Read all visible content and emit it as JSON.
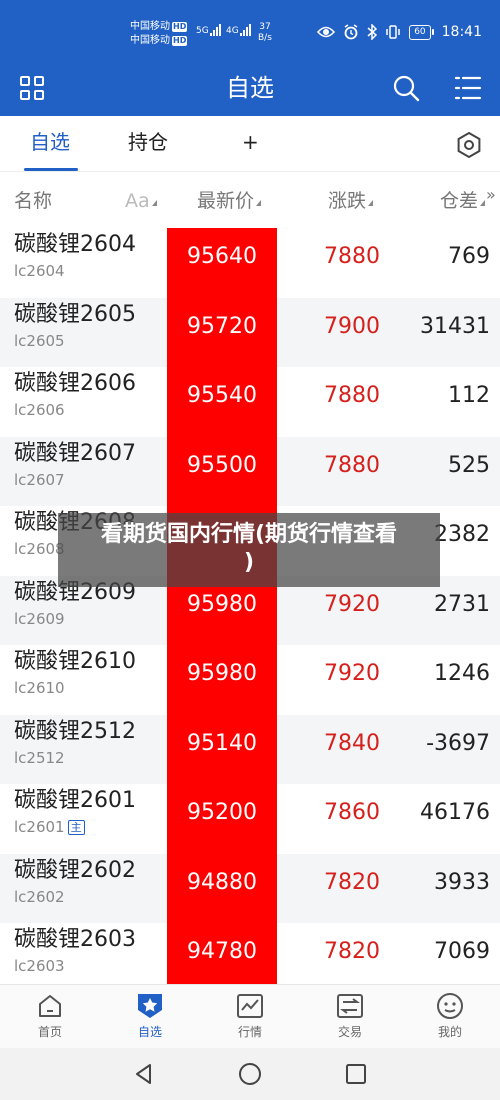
{
  "status_bar": {
    "carrier1": "中国移动",
    "carrier2": "中国移动",
    "hd": "HD",
    "net1": "5G",
    "net2": "4G",
    "speed_value": "37",
    "speed_unit": "B/s",
    "battery": "60",
    "time": "18:41"
  },
  "header": {
    "title": "自选",
    "icons": [
      "grid-menu-icon",
      "search-icon",
      "list-menu-icon"
    ]
  },
  "tabs": {
    "items": [
      "自选",
      "持仓",
      "+"
    ],
    "active": "自选",
    "settings_icon": "hexagon-settings-icon"
  },
  "columns": {
    "name": "名称",
    "font": "Aa",
    "price": "最新价",
    "change": "涨跌",
    "oi": "仓差",
    "more": "»"
  },
  "rows": [
    {
      "name": "碳酸锂2604",
      "code": "lc2604",
      "price": "95640",
      "change": "7880",
      "oi": "769"
    },
    {
      "name": "碳酸锂2605",
      "code": "lc2605",
      "price": "95720",
      "change": "7900",
      "oi": "31431"
    },
    {
      "name": "碳酸锂2606",
      "code": "lc2606",
      "price": "95540",
      "change": "7880",
      "oi": "112"
    },
    {
      "name": "碳酸锂2607",
      "code": "lc2607",
      "price": "95500",
      "change": "7880",
      "oi": "525"
    },
    {
      "name": "碳酸锂2608",
      "code": "lc2608",
      "price": "",
      "change": "",
      "oi": "2382"
    },
    {
      "name": "碳酸锂2609",
      "code": "lc2609",
      "price": "95980",
      "change": "7920",
      "oi": "2731"
    },
    {
      "name": "碳酸锂2610",
      "code": "lc2610",
      "price": "95980",
      "change": "7920",
      "oi": "1246"
    },
    {
      "name": "碳酸锂2512",
      "code": "lc2512",
      "price": "95140",
      "change": "7840",
      "oi": "-3697"
    },
    {
      "name": "碳酸锂2601",
      "code": "lc2601",
      "badge": "主",
      "price": "95200",
      "change": "7860",
      "oi": "46176"
    },
    {
      "name": "碳酸锂2602",
      "code": "lc2602",
      "price": "94880",
      "change": "7820",
      "oi": "3933"
    },
    {
      "name": "碳酸锂2603",
      "code": "lc2603",
      "price": "94780",
      "change": "7820",
      "oi": "7069"
    }
  ],
  "overlay": {
    "line1": "看期货国内行情(期货行情查看",
    "line2": ")"
  },
  "bottom_nav": [
    {
      "label": "首页",
      "icon": "home-icon"
    },
    {
      "label": "自选",
      "icon": "star-shield-icon",
      "active": true
    },
    {
      "label": "行情",
      "icon": "chart-icon"
    },
    {
      "label": "交易",
      "icon": "exchange-icon"
    },
    {
      "label": "我的",
      "icon": "smiley-icon"
    }
  ],
  "colors": {
    "brand_blue": "#2160c4",
    "price_column": "#ff0000",
    "rise_red": "#d6201c"
  }
}
